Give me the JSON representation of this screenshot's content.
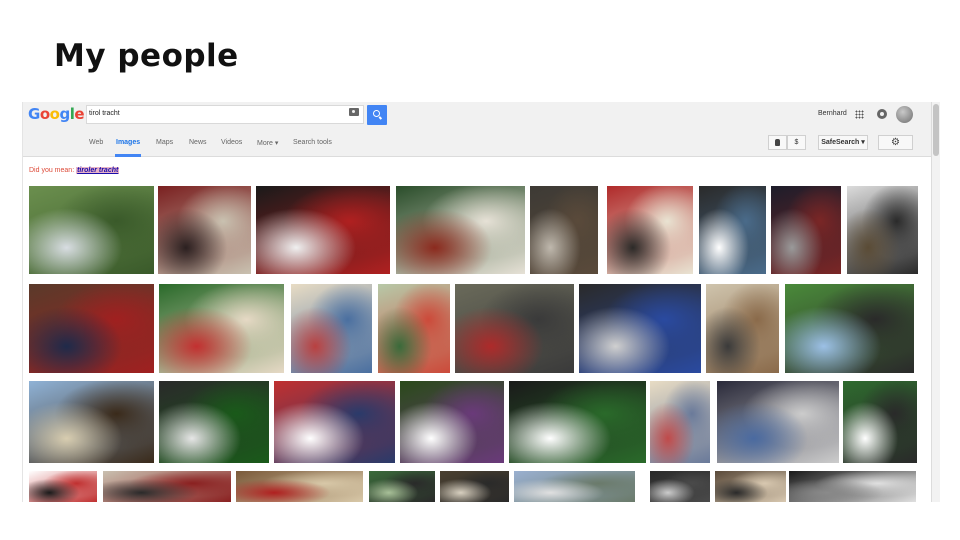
{
  "slide": {
    "title": "My people"
  },
  "google": {
    "logo_letters": [
      {
        "ch": "G",
        "color": "#4285f4"
      },
      {
        "ch": "o",
        "color": "#ea4335"
      },
      {
        "ch": "o",
        "color": "#fbbc05"
      },
      {
        "ch": "g",
        "color": "#4285f4"
      },
      {
        "ch": "l",
        "color": "#34a853"
      },
      {
        "ch": "e",
        "color": "#ea4335"
      }
    ],
    "search": {
      "query": "tirol tracht"
    },
    "user": {
      "name": "Bernhard"
    },
    "tabs": [
      {
        "label": "Web",
        "active": false
      },
      {
        "label": "Images",
        "active": true
      },
      {
        "label": "Maps",
        "active": false
      },
      {
        "label": "News",
        "active": false
      },
      {
        "label": "Videos",
        "active": false
      },
      {
        "label": "More ▾",
        "active": false
      },
      {
        "label": "Search tools",
        "active": false
      }
    ],
    "tools": {
      "size_label": "$",
      "safesearch_label": "SafeSearch ▾",
      "settings_glyph": "⚙"
    },
    "suggestion": {
      "prefix": "Did you mean: ",
      "term": "tiroler tracht"
    },
    "accent_color": "#4285f4"
  }
}
